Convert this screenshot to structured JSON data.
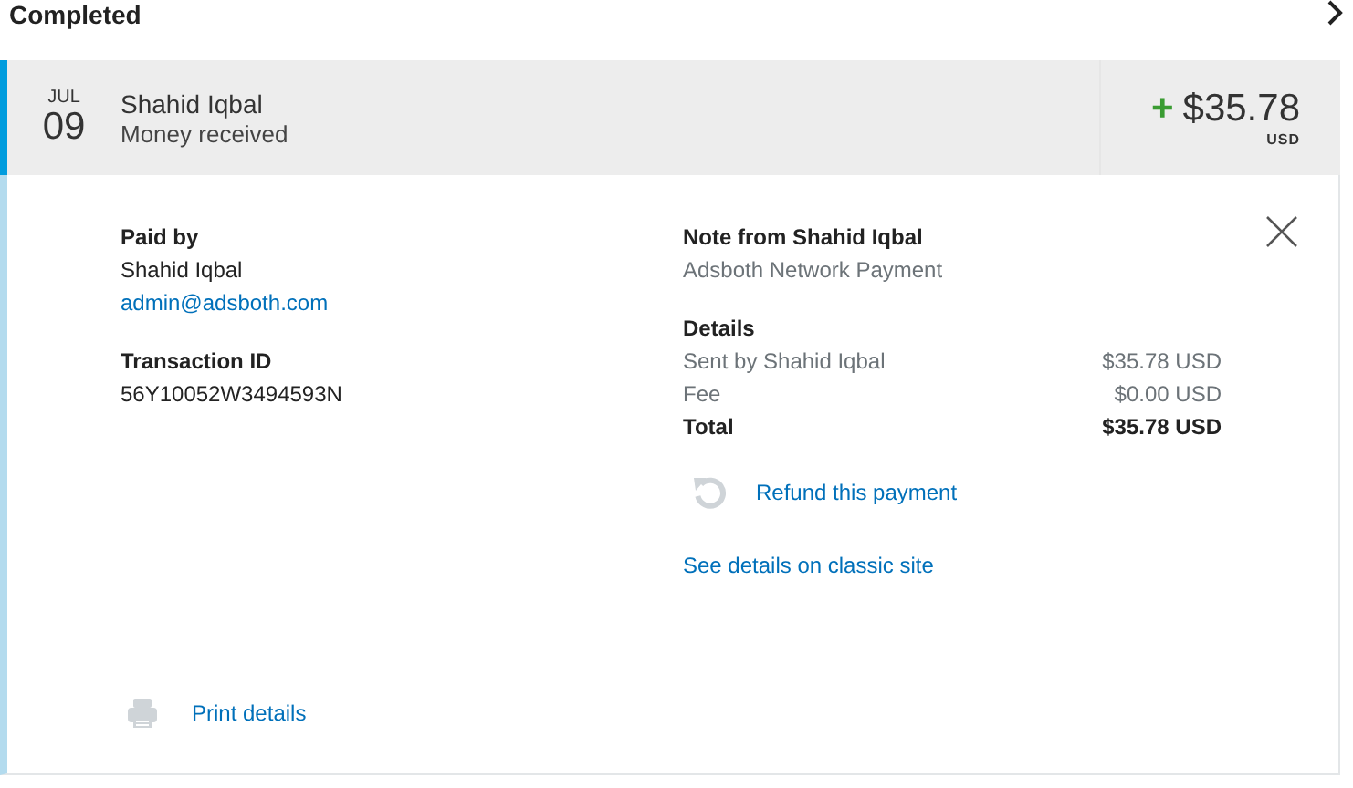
{
  "section": {
    "title": "Completed"
  },
  "transaction": {
    "month": "JUL",
    "day": "09",
    "name": "Shahid Iqbal",
    "type": "Money received",
    "sign": "+",
    "amount": "$35.78",
    "currency": "USD",
    "expanded": true
  },
  "paid_by": {
    "label": "Paid by",
    "name": "Shahid Iqbal",
    "email": "admin@adsboth.com"
  },
  "transaction_id": {
    "label": "Transaction ID",
    "value": "56Y10052W3494593N"
  },
  "note": {
    "label": "Note from Shahid Iqbal",
    "text": "Adsboth Network Payment"
  },
  "details": {
    "label": "Details",
    "rows": [
      {
        "label": "Sent by Shahid Iqbal",
        "value": "$35.78 USD"
      },
      {
        "label": "Fee",
        "value": "$0.00 USD"
      }
    ],
    "total": {
      "label": "Total",
      "value": "$35.78 USD"
    }
  },
  "refund_link": "Refund this payment",
  "classic_link": "See details on classic site",
  "print_link": "Print details"
}
